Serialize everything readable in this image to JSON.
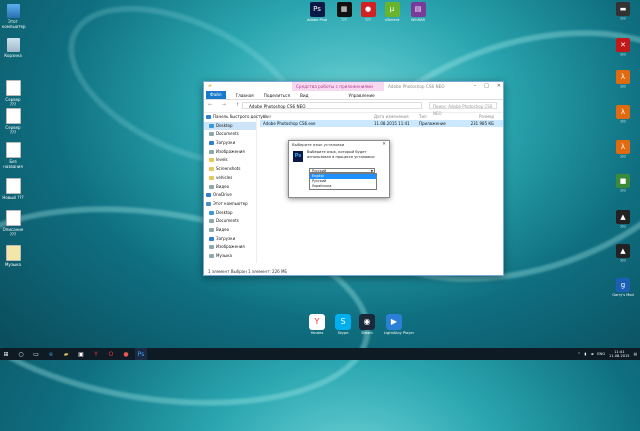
{
  "colors": {
    "accent": "#1979ca",
    "context_tab": "#b03a90",
    "selection": "#cce8ff",
    "highlight": "#1e90ff"
  },
  "desktop_left": [
    {
      "label": "Этот компьютер",
      "icon": "computer-icon"
    },
    {
      "label": "Корзина",
      "icon": "recycle-bin-icon"
    },
    {
      "label": "Сервер ???",
      "icon": "document-icon"
    },
    {
      "label": "Сервер ???",
      "icon": "document-icon"
    },
    {
      "label": "Без названия",
      "icon": "document-icon"
    },
    {
      "label": "Новый ???",
      "icon": "document-icon"
    },
    {
      "label": "Описание ???",
      "icon": "document-icon"
    },
    {
      "label": "Музыка",
      "icon": "music-folder-icon"
    }
  ],
  "desktop_top": [
    {
      "label": "Adobe Photoshop CS6",
      "color": "#0b1a44",
      "glyph": "Ps"
    },
    {
      "label": "???",
      "color": "#111111",
      "glyph": "▦"
    },
    {
      "label": "???",
      "color": "#d32020",
      "glyph": "●"
    },
    {
      "label": "uTorrent",
      "color": "#6ab42d",
      "glyph": "µ"
    },
    {
      "label": "WinRAR",
      "color": "#7a3a9a",
      "glyph": "▤"
    }
  ],
  "desktop_right": [
    {
      "label": "???",
      "color": "#333333",
      "glyph": "▬"
    },
    {
      "label": "???",
      "color": "#c21818",
      "glyph": "✕"
    },
    {
      "label": "???",
      "color": "#e06a10",
      "glyph": "λ"
    },
    {
      "label": "???",
      "color": "#e06a10",
      "glyph": "λ"
    },
    {
      "label": "???",
      "color": "#e06a10",
      "glyph": "λ"
    },
    {
      "label": "???",
      "color": "#3a8a3a",
      "glyph": "■"
    },
    {
      "label": "???",
      "color": "#222222",
      "glyph": "▲"
    },
    {
      "label": "???",
      "color": "#222222",
      "glyph": "▲"
    },
    {
      "label": "Garry's Mod",
      "color": "#1a5fb4",
      "glyph": "g"
    }
  ],
  "dock": [
    {
      "label": "Yandex",
      "color": "#ffffff",
      "glyph": "Y"
    },
    {
      "label": "Skype",
      "color": "#00aff0",
      "glyph": "S"
    },
    {
      "label": "Steam",
      "color": "#1b2838",
      "glyph": "◉"
    },
    {
      "label": "LightAlloy Player",
      "color": "#2a7fd6",
      "glyph": "▶"
    }
  ],
  "explorer": {
    "context_tab": "Средства работы с приложениями",
    "title": "Adobe Photoshop CS6 NEO",
    "ribbon_tabs": [
      "Файл",
      "Главная",
      "Поделиться",
      "Вид",
      "Управление"
    ],
    "path": "Adobe Photoshop CS6 NEO",
    "search_placeholder": "Поиск: Adobe Photoshop CS6 NEO",
    "nav_items": [
      {
        "label": "Панель быстрого доступа",
        "level": 0,
        "color": "#2a7fd6"
      },
      {
        "label": "Desktop",
        "level": 1,
        "color": "#3a9ad9"
      },
      {
        "label": "Documents",
        "level": 1,
        "color": "#8aa"
      },
      {
        "label": "Загрузки",
        "level": 1,
        "color": "#2a7fd6"
      },
      {
        "label": "Изображения",
        "level": 1,
        "color": "#8aa"
      },
      {
        "label": "levels",
        "level": 1,
        "color": "#e8c65a"
      },
      {
        "label": "Screenshots",
        "level": 1,
        "color": "#e8c65a"
      },
      {
        "label": "vehicles",
        "level": 1,
        "color": "#e8c65a"
      },
      {
        "label": "Видео",
        "level": 1,
        "color": "#8aa"
      },
      {
        "label": "OneDrive",
        "level": 0,
        "color": "#2a7fd6"
      },
      {
        "label": "Этот компьютер",
        "level": 0,
        "color": "#4a90c8"
      },
      {
        "label": "Desktop",
        "level": 1,
        "color": "#3a9ad9"
      },
      {
        "label": "Documents",
        "level": 1,
        "color": "#8aa"
      },
      {
        "label": "Видео",
        "level": 1,
        "color": "#8aa"
      },
      {
        "label": "Загрузки",
        "level": 1,
        "color": "#2a7fd6"
      },
      {
        "label": "Изображения",
        "level": 1,
        "color": "#8aa"
      },
      {
        "label": "Музыка",
        "level": 1,
        "color": "#8aa"
      }
    ],
    "columns": [
      "Имя",
      "Дата изменения",
      "Тип",
      "Размер"
    ],
    "rows": [
      {
        "name": "Adobe Photoshop CS6.exe",
        "date": "11.08.2015 11:41",
        "type": "Приложение",
        "size": "231 985 КБ"
      }
    ],
    "status": "1 элемент   Выбран 1 элемент: 226 МБ"
  },
  "dialog": {
    "title": "Выберите язык установки",
    "message": "Выберите язык, который будет использован в процессе установки:",
    "selected": "Русский",
    "options": [
      "English",
      "Русский",
      "Українська"
    ],
    "highlighted_index": 0
  },
  "taskbar": {
    "clock_time": "11:41",
    "clock_date": "11.08.2015",
    "lang": "ENG"
  }
}
